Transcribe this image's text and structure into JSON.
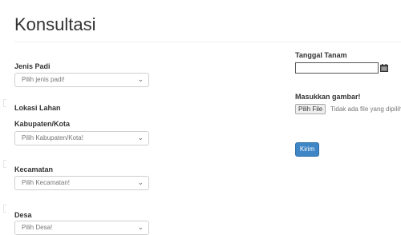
{
  "page": {
    "title": "Konsultasi"
  },
  "form_left": {
    "jenis_padi": {
      "label": "Jenis Padi",
      "select_value": "Pilih jenis padi!"
    },
    "lokasi_lahan": {
      "label": "Lokasi Lahan"
    },
    "kabupaten": {
      "label": "Kabupaten/Kota",
      "select_value": "Pilih Kabupaten/Kota!"
    },
    "kecamatan": {
      "label": "Kecamatan",
      "select_value": "Pilih Kecamatan!"
    },
    "desa": {
      "label": "Desa",
      "select_value": "Pilih Desa!"
    }
  },
  "form_right": {
    "tanggal_tanam": {
      "label": "Tanggal Tanam",
      "value": ""
    },
    "gambar": {
      "label": "Masukkan gambar!",
      "file_button": "Pilih File",
      "file_status": "Tidak ada file yang dipilih"
    },
    "submit_label": "Kirim"
  },
  "icons": {
    "calendar": "calendar-icon",
    "chevron": "chevron-down-icon"
  },
  "colors": {
    "accent": "#3f86c6",
    "border": "#cfcfcf"
  }
}
